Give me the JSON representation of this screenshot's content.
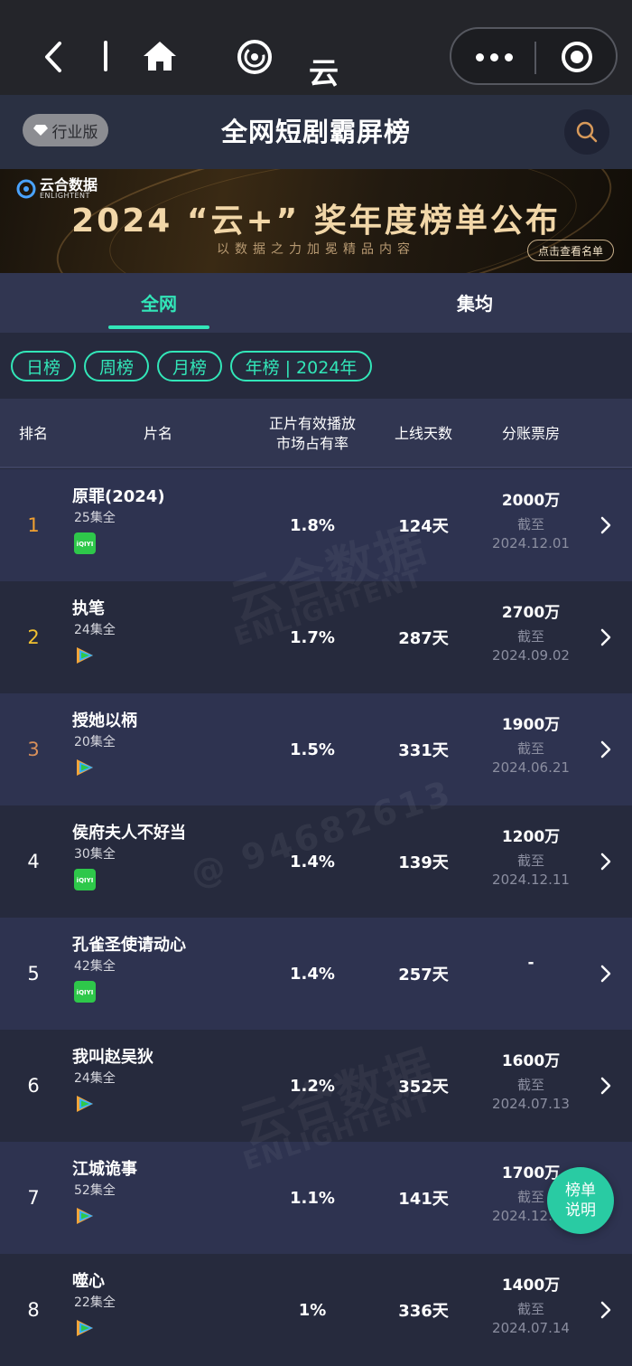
{
  "topbar": {
    "brand_name": "云合数据"
  },
  "header": {
    "badge_label": "行业版",
    "title": "全网短剧霸屏榜"
  },
  "banner": {
    "logo_text": "云合数据",
    "logo_sub": "ENLIGHTENT",
    "headline": "2024 “云+” 奖年度榜单公布",
    "subtitle": "以数据之力加冕精品内容",
    "cta": "点击查看名单"
  },
  "tabs": [
    {
      "label": "全网",
      "active": true
    },
    {
      "label": "集均",
      "active": false
    }
  ],
  "chips": [
    "日榜",
    "周榜",
    "月榜",
    "年榜 | 2024年"
  ],
  "columns": {
    "rank": "排名",
    "name": "片名",
    "share_line1": "正片有效播放",
    "share_line2": "市场占有率",
    "days": "上线天数",
    "box": "分账票房"
  },
  "rows": [
    {
      "rank": "1",
      "rank_color": "#f0a030",
      "name": "原罪(2024)",
      "eps": "25集全",
      "platform": "iqiyi",
      "share": "1.8%",
      "days": "124天",
      "box": "2000万",
      "until": "截至",
      "date": "2024.12.01"
    },
    {
      "rank": "2",
      "rank_color": "#f0c030",
      "name": "执笔",
      "eps": "24集全",
      "platform": "tencent",
      "share": "1.7%",
      "days": "287天",
      "box": "2700万",
      "until": "截至",
      "date": "2024.09.02"
    },
    {
      "rank": "3",
      "rank_color": "#d8905a",
      "name": "授她以柄",
      "eps": "20集全",
      "platform": "tencent",
      "share": "1.5%",
      "days": "331天",
      "box": "1900万",
      "until": "截至",
      "date": "2024.06.21"
    },
    {
      "rank": "4",
      "rank_color": "#ffffff",
      "name": "侯府夫人不好当",
      "eps": "30集全",
      "platform": "iqiyi",
      "share": "1.4%",
      "days": "139天",
      "box": "1200万",
      "until": "截至",
      "date": "2024.12.11"
    },
    {
      "rank": "5",
      "rank_color": "#ffffff",
      "name": "孔雀圣使请动心",
      "eps": "42集全",
      "platform": "iqiyi",
      "share": "1.4%",
      "days": "257天",
      "box": "-",
      "until": "",
      "date": ""
    },
    {
      "rank": "6",
      "rank_color": "#ffffff",
      "name": "我叫赵吴狄",
      "eps": "24集全",
      "platform": "tencent",
      "share": "1.2%",
      "days": "352天",
      "box": "1600万",
      "until": "截至",
      "date": "2024.07.13"
    },
    {
      "rank": "7",
      "rank_color": "#ffffff",
      "name": "江城诡事",
      "eps": "52集全",
      "platform": "tencent",
      "share": "1.1%",
      "days": "141天",
      "box": "1700万",
      "until": "截至",
      "date": "2024.12.10"
    },
    {
      "rank": "8",
      "rank_color": "#ffffff",
      "name": "噬心",
      "eps": "22集全",
      "platform": "tencent",
      "share": "1%",
      "days": "336天",
      "box": "1400万",
      "until": "截至",
      "date": "2024.07.14"
    }
  ],
  "watermarks": {
    "brand": "云合数据",
    "brand_en": "ENLIGHTENT",
    "user_id": "@ 94682613"
  },
  "fab": {
    "line1": "榜单",
    "line2": "说明"
  },
  "colors": {
    "accent": "#32e6b8",
    "bg": "#262a3d",
    "row_alt": "#2e3350"
  }
}
